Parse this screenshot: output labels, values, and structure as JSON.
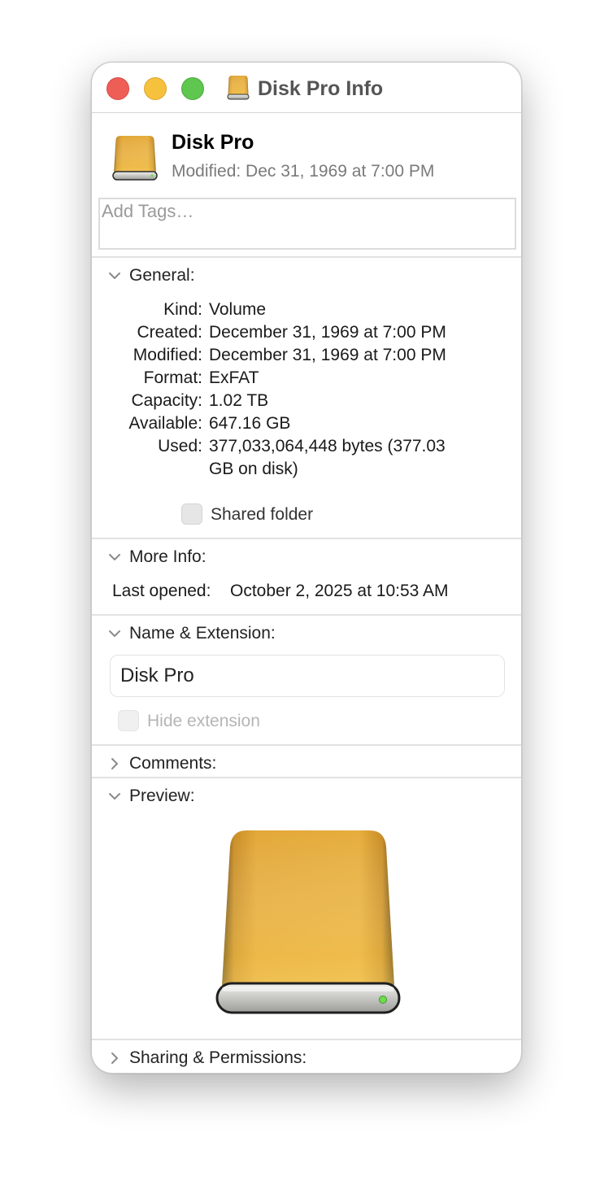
{
  "window": {
    "title": "Disk Pro Info"
  },
  "header": {
    "name": "Disk Pro",
    "modified": "Modified: Dec 31, 1969 at 7:00 PM",
    "tags_placeholder": "Add Tags…",
    "tags_value": ""
  },
  "general": {
    "title": "General:",
    "rows": [
      {
        "label": "Kind:",
        "value": "Volume"
      },
      {
        "label": "Created:",
        "value": "December 31, 1969 at 7:00 PM"
      },
      {
        "label": "Modified:",
        "value": "December 31, 1969 at 7:00 PM"
      },
      {
        "label": "Format:",
        "value": "ExFAT"
      },
      {
        "label": "Capacity:",
        "value": "1.02 TB"
      },
      {
        "label": "Available:",
        "value": "647.16 GB"
      },
      {
        "label": "Used:",
        "value": "377,033,064,448 bytes (377.03",
        "value_line2": "GB on disk)"
      }
    ],
    "shared_folder_label": "Shared folder",
    "shared_folder_checked": false
  },
  "more_info": {
    "title": "More Info:",
    "last_opened_label": "Last opened:",
    "last_opened_value": "October 2, 2025 at 10:53 AM"
  },
  "name_extension": {
    "title": "Name & Extension:",
    "name_value": "Disk Pro",
    "hide_extension_label": "Hide extension",
    "hide_extension_enabled": false
  },
  "comments": {
    "title": "Comments:",
    "expanded": false
  },
  "preview": {
    "title": "Preview:",
    "expanded": true
  },
  "sharing": {
    "title": "Sharing & Permissions:",
    "expanded": false
  },
  "icons": {
    "close": "close-window-button",
    "minimize": "minimize-window-button",
    "zoom": "zoom-window-button",
    "drive": "external-drive-icon",
    "expanded": "chevron-down-icon",
    "collapsed": "chevron-right-icon"
  },
  "colors": {
    "close": "#ee5e57",
    "minimize": "#f6c13c",
    "zoom": "#5fc64f",
    "drive_gold": "#e0a83a"
  }
}
